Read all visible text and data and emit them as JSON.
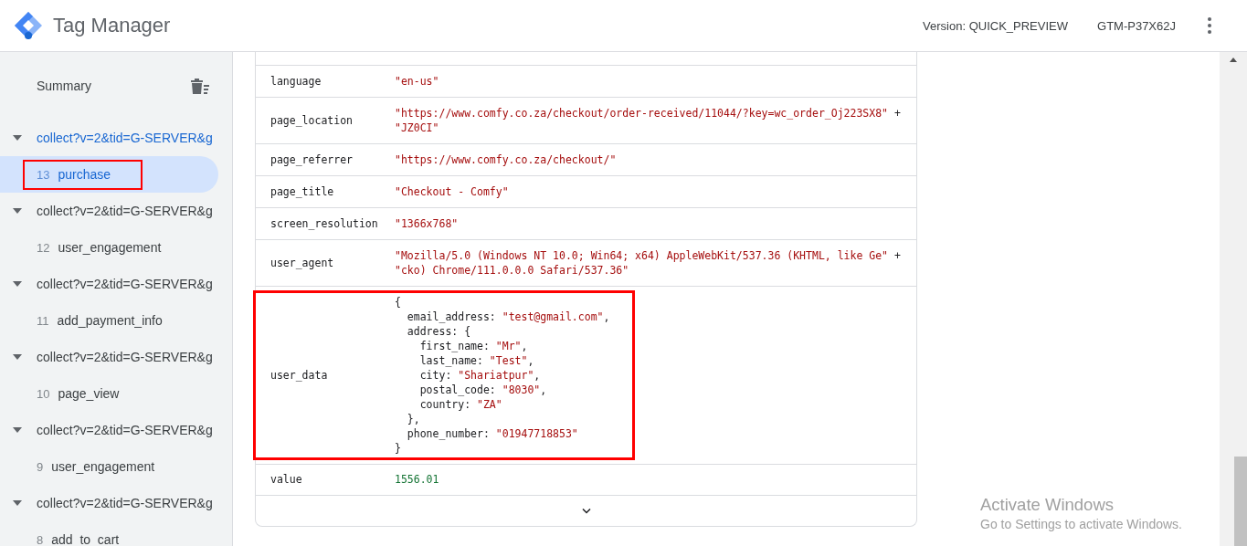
{
  "header": {
    "product": "Tag Manager",
    "version": "Version: QUICK_PREVIEW",
    "container_id": "GTM-P37X62J"
  },
  "sidebar": {
    "summary": "Summary",
    "items": [
      {
        "label": "collect?v=2&tid=G-SERVER&g",
        "expanded": true,
        "children": [
          {
            "number": "13",
            "label": "purchase",
            "selected": true,
            "highlighted": true
          }
        ]
      },
      {
        "label": "collect?v=2&tid=G-SERVER&g",
        "expanded": true,
        "children": [
          {
            "number": "12",
            "label": "user_engagement",
            "selected": false,
            "highlighted": false
          }
        ]
      },
      {
        "label": "collect?v=2&tid=G-SERVER&g",
        "expanded": true,
        "children": [
          {
            "number": "11",
            "label": "add_payment_info",
            "selected": false,
            "highlighted": false
          }
        ]
      },
      {
        "label": "collect?v=2&tid=G-SERVER&g",
        "expanded": true,
        "children": [
          {
            "number": "10",
            "label": "page_view",
            "selected": false,
            "highlighted": false
          }
        ]
      },
      {
        "label": "collect?v=2&tid=G-SERVER&g",
        "expanded": true,
        "children": [
          {
            "number": "9",
            "label": "user_engagement",
            "selected": false,
            "highlighted": false
          }
        ]
      },
      {
        "label": "collect?v=2&tid=G-SERVER&g",
        "expanded": true,
        "children": [
          {
            "number": "8",
            "label": "add_to_cart",
            "selected": false,
            "highlighted": false
          }
        ]
      }
    ]
  },
  "table": {
    "rows": [
      {
        "key": "language",
        "highlighted": false,
        "lines": [
          [
            {
              "text": "\"en-us\"",
              "kind": "string"
            }
          ]
        ]
      },
      {
        "key": "page_location",
        "highlighted": false,
        "lines": [
          [
            {
              "text": "\"https://www.comfy.co.za/checkout/order-received/11044/?key=wc_order_Oj223SX8\"",
              "kind": "string"
            },
            {
              "text": " +",
              "kind": "punct"
            }
          ],
          [
            {
              "text": "\"JZ0CI\"",
              "kind": "string"
            }
          ]
        ]
      },
      {
        "key": "page_referrer",
        "highlighted": false,
        "lines": [
          [
            {
              "text": "\"https://www.comfy.co.za/checkout/\"",
              "kind": "string"
            }
          ]
        ]
      },
      {
        "key": "page_title",
        "highlighted": false,
        "lines": [
          [
            {
              "text": "\"Checkout - Comfy\"",
              "kind": "string"
            }
          ]
        ]
      },
      {
        "key": "screen_resolution",
        "highlighted": false,
        "lines": [
          [
            {
              "text": "\"1366x768\"",
              "kind": "string"
            }
          ]
        ]
      },
      {
        "key": "user_agent",
        "highlighted": false,
        "lines": [
          [
            {
              "text": "\"Mozilla/5.0 (Windows NT 10.0; Win64; x64) AppleWebKit/537.36 (KHTML, like Ge\"",
              "kind": "string"
            },
            {
              "text": " +",
              "kind": "punct"
            }
          ],
          [
            {
              "text": "\"cko) Chrome/111.0.0.0 Safari/537.36\"",
              "kind": "string"
            }
          ]
        ]
      },
      {
        "key": "user_data",
        "highlighted": true,
        "lines": [
          [
            {
              "text": "{",
              "kind": "punct"
            }
          ],
          [
            {
              "text": "  email_address: ",
              "kind": "punct"
            },
            {
              "text": "\"test@gmail.com\"",
              "kind": "string"
            },
            {
              "text": ",",
              "kind": "punct"
            }
          ],
          [
            {
              "text": "  address: {",
              "kind": "punct"
            }
          ],
          [
            {
              "text": "    first_name: ",
              "kind": "punct"
            },
            {
              "text": "\"Mr\"",
              "kind": "string"
            },
            {
              "text": ",",
              "kind": "punct"
            }
          ],
          [
            {
              "text": "    last_name: ",
              "kind": "punct"
            },
            {
              "text": "\"Test\"",
              "kind": "string"
            },
            {
              "text": ",",
              "kind": "punct"
            }
          ],
          [
            {
              "text": "    city: ",
              "kind": "punct"
            },
            {
              "text": "\"Shariatpur\"",
              "kind": "string"
            },
            {
              "text": ",",
              "kind": "punct"
            }
          ],
          [
            {
              "text": "    postal_code: ",
              "kind": "punct"
            },
            {
              "text": "\"8030\"",
              "kind": "string"
            },
            {
              "text": ",",
              "kind": "punct"
            }
          ],
          [
            {
              "text": "    country: ",
              "kind": "punct"
            },
            {
              "text": "\"ZA\"",
              "kind": "string"
            }
          ],
          [
            {
              "text": "  },",
              "kind": "punct"
            }
          ],
          [
            {
              "text": "  phone_number: ",
              "kind": "punct"
            },
            {
              "text": "\"01947718853\"",
              "kind": "string"
            }
          ],
          [
            {
              "text": "}",
              "kind": "punct"
            }
          ]
        ]
      },
      {
        "key": "value",
        "highlighted": false,
        "lines": [
          [
            {
              "text": "1556.01",
              "kind": "number"
            }
          ]
        ]
      }
    ]
  },
  "os_notice": {
    "title": "Activate Windows",
    "subtitle": "Go to Settings to activate Windows."
  }
}
